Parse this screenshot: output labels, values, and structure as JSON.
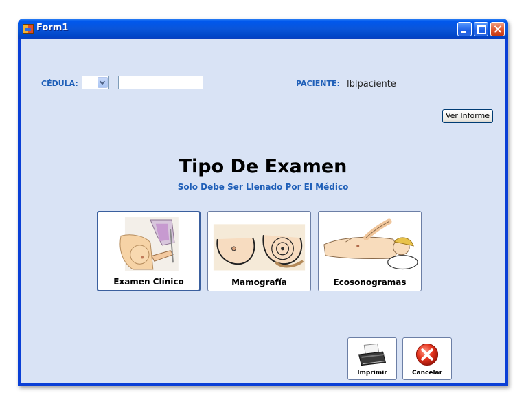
{
  "window": {
    "title": "Form1",
    "controls": [
      "minimize",
      "maximize",
      "close"
    ]
  },
  "form": {
    "cedula_label": "CÉDULA:",
    "cedula_combo_value": "",
    "cedula_text_value": "",
    "paciente_label": "PACIENTE:",
    "paciente_value": "lblpaciente",
    "ver_informe_label": "Ver Informe"
  },
  "main": {
    "title": "Tipo De Examen",
    "subtitle": "Solo Debe Ser Llenado Por El Médico",
    "exam_buttons": [
      {
        "label": "Examen Clínico",
        "icon": "clinical-exam-illustration"
      },
      {
        "label": "Mamografía",
        "icon": "mammography-illustration"
      },
      {
        "label": "Ecosonogramas",
        "icon": "ultrasound-illustration"
      }
    ]
  },
  "actions": {
    "print_label": "Imprimir",
    "cancel_label": "Cancelar"
  },
  "colors": {
    "accent": "#1f5fb8",
    "client_bg": "#d9e3f5",
    "titlebar": "#0a55d9"
  }
}
